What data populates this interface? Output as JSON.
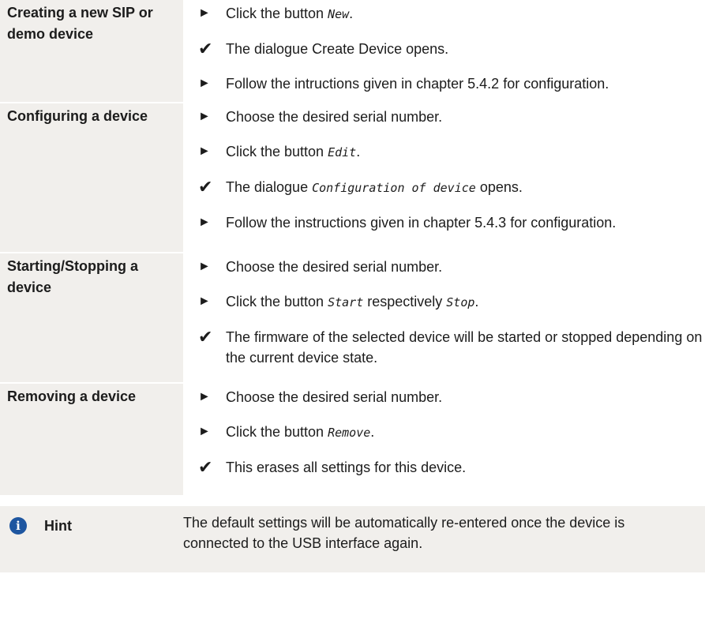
{
  "icons": {
    "action": "►",
    "result": "✔"
  },
  "sections": [
    {
      "title": "Creating a new SIP or demo device",
      "steps": [
        {
          "type": "action",
          "parts": [
            {
              "t": "Click the button "
            },
            {
              "t": "New",
              "code": true
            },
            {
              "t": "."
            }
          ]
        },
        {
          "type": "result",
          "parts": [
            {
              "t": "The dialogue Create Device opens."
            }
          ]
        },
        {
          "type": "action",
          "parts": [
            {
              "t": "Follow the intructions given in chapter 5.4.2 for configuration."
            }
          ]
        }
      ]
    },
    {
      "title": "Configuring a device",
      "steps": [
        {
          "type": "action",
          "parts": [
            {
              "t": "Choose the desired serial number."
            }
          ]
        },
        {
          "type": "action",
          "parts": [
            {
              "t": "Click the button "
            },
            {
              "t": "Edit",
              "code": true
            },
            {
              "t": "."
            }
          ]
        },
        {
          "type": "result",
          "parts": [
            {
              "t": "The dialogue "
            },
            {
              "t": "Configuration of device",
              "code": true
            },
            {
              "t": " opens."
            }
          ]
        },
        {
          "type": "action",
          "parts": [
            {
              "t": "Follow the instructions given in chapter 5.4.3 for configuration."
            }
          ]
        }
      ]
    },
    {
      "title": "Starting/Stopping a device",
      "steps": [
        {
          "type": "action",
          "parts": [
            {
              "t": "Choose the desired serial number."
            }
          ]
        },
        {
          "type": "action",
          "parts": [
            {
              "t": "Click the button "
            },
            {
              "t": "Start",
              "code": true
            },
            {
              "t": " respectively "
            },
            {
              "t": "Stop",
              "code": true
            },
            {
              "t": "."
            }
          ]
        },
        {
          "type": "result",
          "parts": [
            {
              "t": "The firmware of the selected device will be started or stopped depending on the current device state."
            }
          ]
        }
      ]
    },
    {
      "title": "Removing a device",
      "steps": [
        {
          "type": "action",
          "parts": [
            {
              "t": "Choose the desired serial number."
            }
          ]
        },
        {
          "type": "action",
          "parts": [
            {
              "t": "Click the button "
            },
            {
              "t": "Remove",
              "code": true
            },
            {
              "t": "."
            }
          ]
        },
        {
          "type": "result",
          "parts": [
            {
              "t": "This erases all settings for this device."
            }
          ]
        }
      ]
    }
  ],
  "hint": {
    "icon": "info-icon",
    "icon_glyph": "i",
    "label": "Hint",
    "text": "The default settings will be automatically re-entered once the device is connected to the USB interface again."
  }
}
